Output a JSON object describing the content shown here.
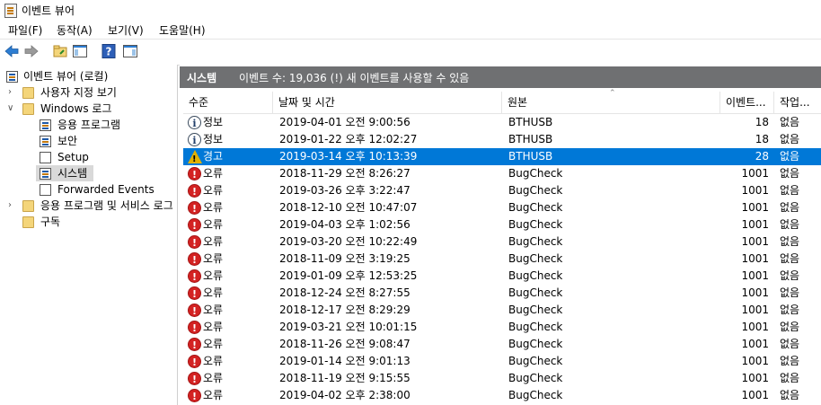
{
  "window": {
    "title": "이벤트 뷰어"
  },
  "menu": [
    "파일(F)",
    "동작(A)",
    "보기(V)",
    "도움말(H)"
  ],
  "toolbar": {
    "icons": [
      "back-arrow-icon",
      "forward-arrow-icon",
      "open-folder-icon",
      "console-tree-icon",
      "help-icon",
      "action-pane-icon"
    ]
  },
  "tree": {
    "root": "이벤트 뷰어 (로컬)",
    "custom_views": "사용자 지정 보기",
    "windows_logs": "Windows 로그",
    "windows_children": [
      "응용 프로그램",
      "보안",
      "Setup",
      "시스템",
      "Forwarded Events"
    ],
    "app_services": "응용 프로그램 및 서비스 로그",
    "subscriptions": "구독"
  },
  "header": {
    "title": "시스템",
    "info": "이벤트 수: 19,036 (!) 새 이벤트를 사용할 수 있음"
  },
  "columns": [
    "수준",
    "날짜 및 시간",
    "원본",
    "이벤트...",
    "작업..."
  ],
  "events": [
    {
      "level": "정보",
      "type": "info",
      "datetime": "2019-04-01 오전 9:00:56",
      "source": "BTHUSB",
      "id": "18",
      "task": "없음"
    },
    {
      "level": "정보",
      "type": "info",
      "datetime": "2019-01-22 오후 12:02:27",
      "source": "BTHUSB",
      "id": "18",
      "task": "없음"
    },
    {
      "level": "경고",
      "type": "warning",
      "datetime": "2019-03-14 오후 10:13:39",
      "source": "BTHUSB",
      "id": "28",
      "task": "없음",
      "selected": true
    },
    {
      "level": "오류",
      "type": "error",
      "datetime": "2018-11-29 오전 8:26:27",
      "source": "BugCheck",
      "id": "1001",
      "task": "없음"
    },
    {
      "level": "오류",
      "type": "error",
      "datetime": "2019-03-26 오후 3:22:47",
      "source": "BugCheck",
      "id": "1001",
      "task": "없음"
    },
    {
      "level": "오류",
      "type": "error",
      "datetime": "2018-12-10 오전 10:47:07",
      "source": "BugCheck",
      "id": "1001",
      "task": "없음"
    },
    {
      "level": "오류",
      "type": "error",
      "datetime": "2019-04-03 오후 1:02:56",
      "source": "BugCheck",
      "id": "1001",
      "task": "없음"
    },
    {
      "level": "오류",
      "type": "error",
      "datetime": "2019-03-20 오전 10:22:49",
      "source": "BugCheck",
      "id": "1001",
      "task": "없음"
    },
    {
      "level": "오류",
      "type": "error",
      "datetime": "2018-11-09 오전 3:19:25",
      "source": "BugCheck",
      "id": "1001",
      "task": "없음"
    },
    {
      "level": "오류",
      "type": "error",
      "datetime": "2019-01-09 오후 12:53:25",
      "source": "BugCheck",
      "id": "1001",
      "task": "없음"
    },
    {
      "level": "오류",
      "type": "error",
      "datetime": "2018-12-24 오전 8:27:55",
      "source": "BugCheck",
      "id": "1001",
      "task": "없음"
    },
    {
      "level": "오류",
      "type": "error",
      "datetime": "2018-12-17 오전 8:29:29",
      "source": "BugCheck",
      "id": "1001",
      "task": "없음"
    },
    {
      "level": "오류",
      "type": "error",
      "datetime": "2019-03-21 오전 10:01:15",
      "source": "BugCheck",
      "id": "1001",
      "task": "없음"
    },
    {
      "level": "오류",
      "type": "error",
      "datetime": "2018-11-26 오전 9:08:47",
      "source": "BugCheck",
      "id": "1001",
      "task": "없음"
    },
    {
      "level": "오류",
      "type": "error",
      "datetime": "2019-01-14 오전 9:01:13",
      "source": "BugCheck",
      "id": "1001",
      "task": "없음"
    },
    {
      "level": "오류",
      "type": "error",
      "datetime": "2018-11-19 오전 9:15:55",
      "source": "BugCheck",
      "id": "1001",
      "task": "없음"
    },
    {
      "level": "오류",
      "type": "error",
      "datetime": "2019-04-02 오후 2:38:00",
      "source": "BugCheck",
      "id": "1001",
      "task": "없음"
    }
  ],
  "colors": {
    "header_bar": "#6f7072",
    "selection": "#0078d7",
    "error": "#d32222",
    "warning": "#e3b100"
  }
}
